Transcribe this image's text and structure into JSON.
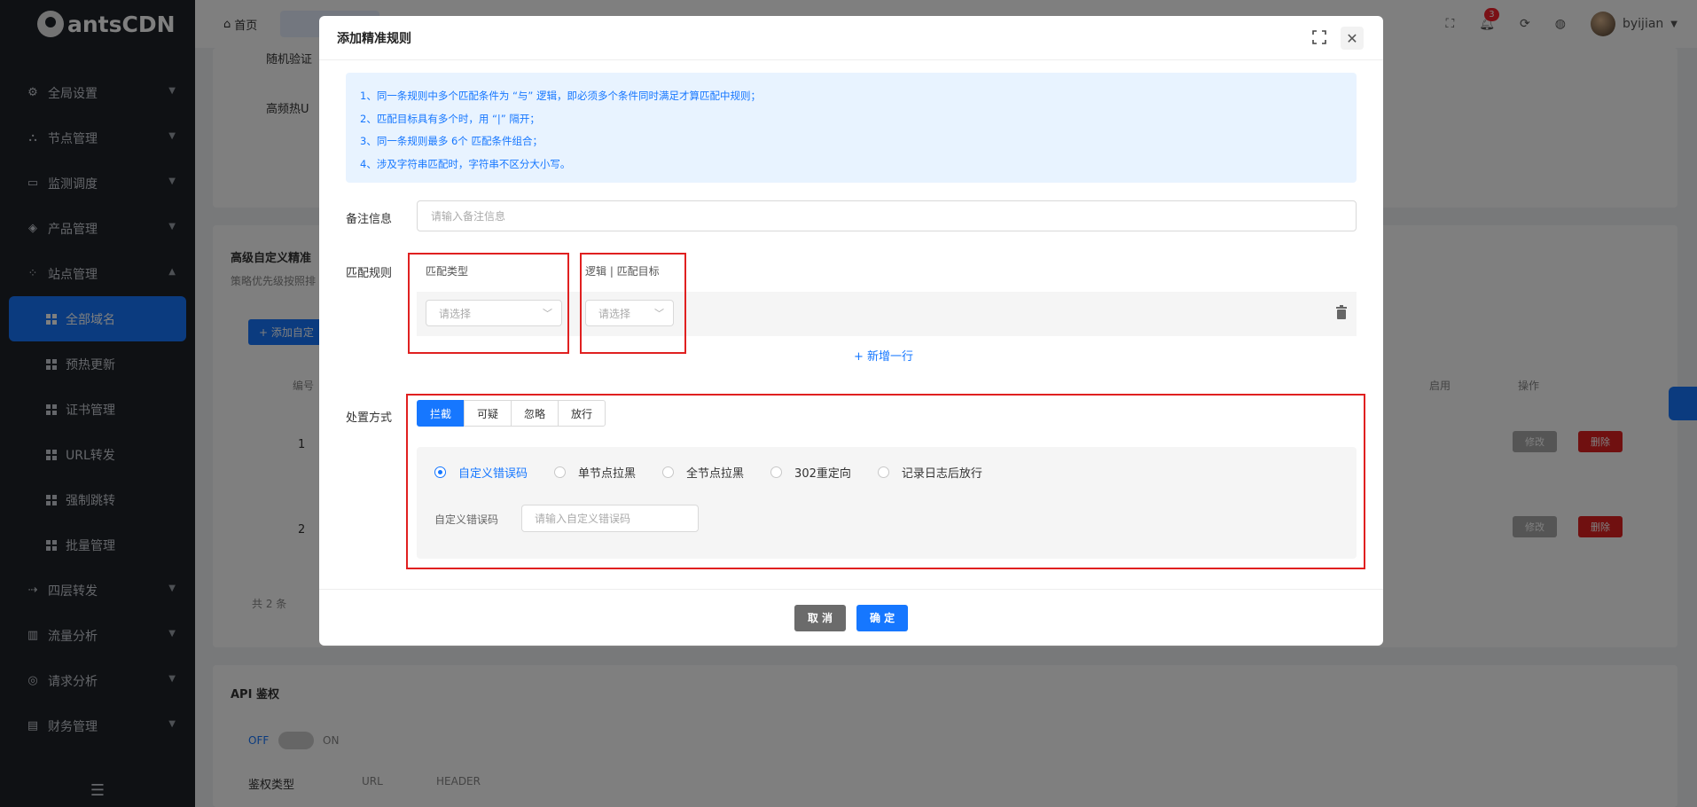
{
  "app": {
    "brand": "antsCDN"
  },
  "sidebar": {
    "items": [
      {
        "label": "全局设置",
        "icon": "settings-icon"
      },
      {
        "label": "节点管理",
        "icon": "node-tree-icon"
      },
      {
        "label": "监测调度",
        "icon": "monitor-icon"
      },
      {
        "label": "产品管理",
        "icon": "cube-icon"
      },
      {
        "label": "站点管理",
        "icon": "site-icon"
      }
    ],
    "sub_items": [
      {
        "label": "全部域名"
      },
      {
        "label": "预热更新"
      },
      {
        "label": "证书管理"
      },
      {
        "label": "URL转发"
      },
      {
        "label": "强制跳转"
      },
      {
        "label": "批量管理"
      }
    ],
    "bottom_items": [
      {
        "label": "四层转发",
        "icon": "forward-icon"
      },
      {
        "label": "流量分析",
        "icon": "bar-chart-icon"
      },
      {
        "label": "请求分析",
        "icon": "request-icon"
      },
      {
        "label": "财务管理",
        "icon": "wallet-icon"
      }
    ]
  },
  "topbar": {
    "home": "首页",
    "notification_count": "3",
    "username": "byijian"
  },
  "background": {
    "row1": "随机验证",
    "row2": "高频热U",
    "section_title": "高级自定义精准",
    "section_desc": "策略优先级按照排",
    "add_button": "+ 添加自定",
    "col_no": "编号",
    "col_enable": "启用",
    "col_ops": "操作",
    "rows": [
      "1",
      "2"
    ],
    "edit": "修改",
    "delete": "删除",
    "total": "共 2 条",
    "api_title": "API 鉴权",
    "off": "OFF",
    "on": "ON",
    "auth_type": "鉴权类型",
    "opt_url": "URL",
    "opt_header": "HEADER"
  },
  "modal": {
    "title": "添加精准规则",
    "tips": [
      "1、同一条规则中多个匹配条件为 “与” 逻辑，即必须多个条件同时满足才算匹配中规则；",
      "2、匹配目标具有多个时，用 “|” 隔开；",
      "3、同一条规则最多 6个 匹配条件组合；",
      "4、涉及字符串匹配时，字符串不区分大小写。"
    ],
    "remark_label": "备注信息",
    "remark_placeholder": "请输入备注信息",
    "rule_label": "匹配规则",
    "col_match_type": "匹配类型",
    "col_logic_target": "逻辑 | 匹配目标",
    "select_placeholder": "请选择",
    "add_row": "+ 新增一行",
    "action_label": "处置方式",
    "action_tabs": [
      "拦截",
      "可疑",
      "忽略",
      "放行"
    ],
    "active_tab": "拦截",
    "radio_options": [
      "自定义错误码",
      "单节点拉黑",
      "全节点拉黑",
      "302重定向",
      "记录日志后放行"
    ],
    "selected_option": "自定义错误码",
    "error_code_label": "自定义错误码",
    "error_code_placeholder": "请输入自定义错误码",
    "cancel": "取 消",
    "confirm": "确 定"
  },
  "colors": {
    "primary": "#1677ff",
    "sidebar_bg": "#1f2329",
    "highlight_border": "#e02020",
    "danger": "#e02020"
  }
}
